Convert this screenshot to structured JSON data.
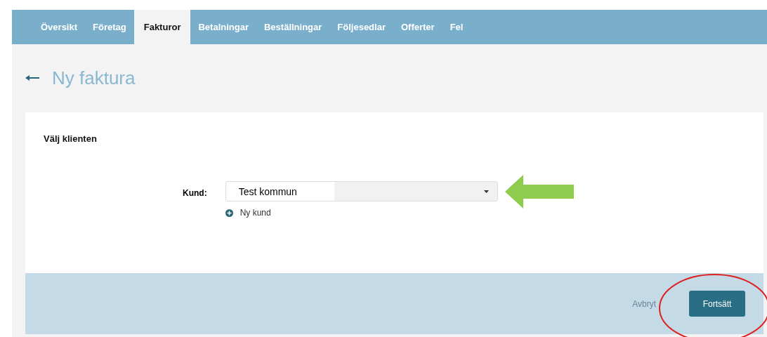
{
  "tabs": [
    {
      "label": "Översikt",
      "selected": false
    },
    {
      "label": "Företag",
      "selected": false
    },
    {
      "label": "Fakturor",
      "selected": true
    },
    {
      "label": "Betalningar",
      "selected": false
    },
    {
      "label": "Beställningar",
      "selected": false
    },
    {
      "label": "Följesedlar",
      "selected": false
    },
    {
      "label": "Offerter",
      "selected": false
    },
    {
      "label": "Fel",
      "selected": false
    }
  ],
  "page_title": "Ny faktura",
  "section_title": "Välj klienten",
  "customer_field": {
    "label": "Kund:",
    "value": "Test kommun"
  },
  "new_customer_link": "Ny kund",
  "footer": {
    "cancel_link": "Avbryt",
    "continue_button": "Fortsätt"
  }
}
